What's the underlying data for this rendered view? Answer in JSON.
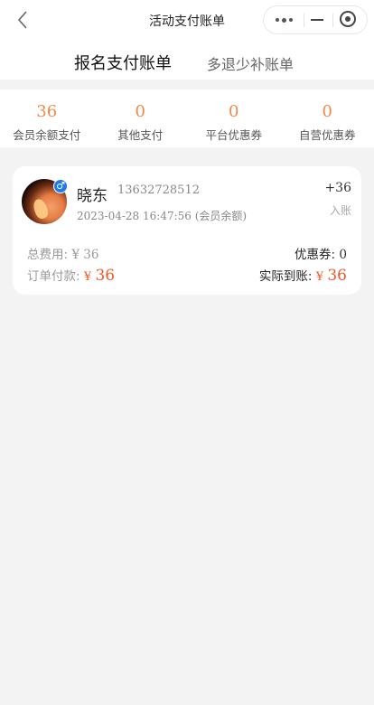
{
  "navbar": {
    "title": "活动支付账单",
    "back_icon": "chevron-left-icon",
    "capsule": {
      "more_icon": "more-dots-icon",
      "minimize_icon": "minimize-icon",
      "close_icon": "target-close-icon"
    }
  },
  "tabs": [
    {
      "label": "报名支付账单",
      "active": true
    },
    {
      "label": "多退少补账单",
      "active": false
    }
  ],
  "stats": [
    {
      "value": "36",
      "label": "会员余额支付"
    },
    {
      "value": "0",
      "label": "其他支付"
    },
    {
      "value": "0",
      "label": "平台优惠券"
    },
    {
      "value": "0",
      "label": "自营优惠券"
    }
  ],
  "colors": {
    "accent": "#f08a4b",
    "price_red": "#ee5a2c",
    "badge_blue": "#1e7bea"
  },
  "bill": {
    "gender_icon": "male-icon",
    "gender_symbol": "♂",
    "name": "晓东",
    "phone": "13632728512",
    "time": "2023-04-28 16:47:56 (会员余额)",
    "amount_change": "+36",
    "amount_type": "入账",
    "total_label": "总费用:",
    "total_value": "¥ 36",
    "coupon_label": "优惠券:",
    "coupon_value": "0",
    "order_label": "订单付款:",
    "order_currency": "¥",
    "order_value": "36",
    "received_label": "实际到账:",
    "received_currency": "¥",
    "received_value": "36"
  }
}
